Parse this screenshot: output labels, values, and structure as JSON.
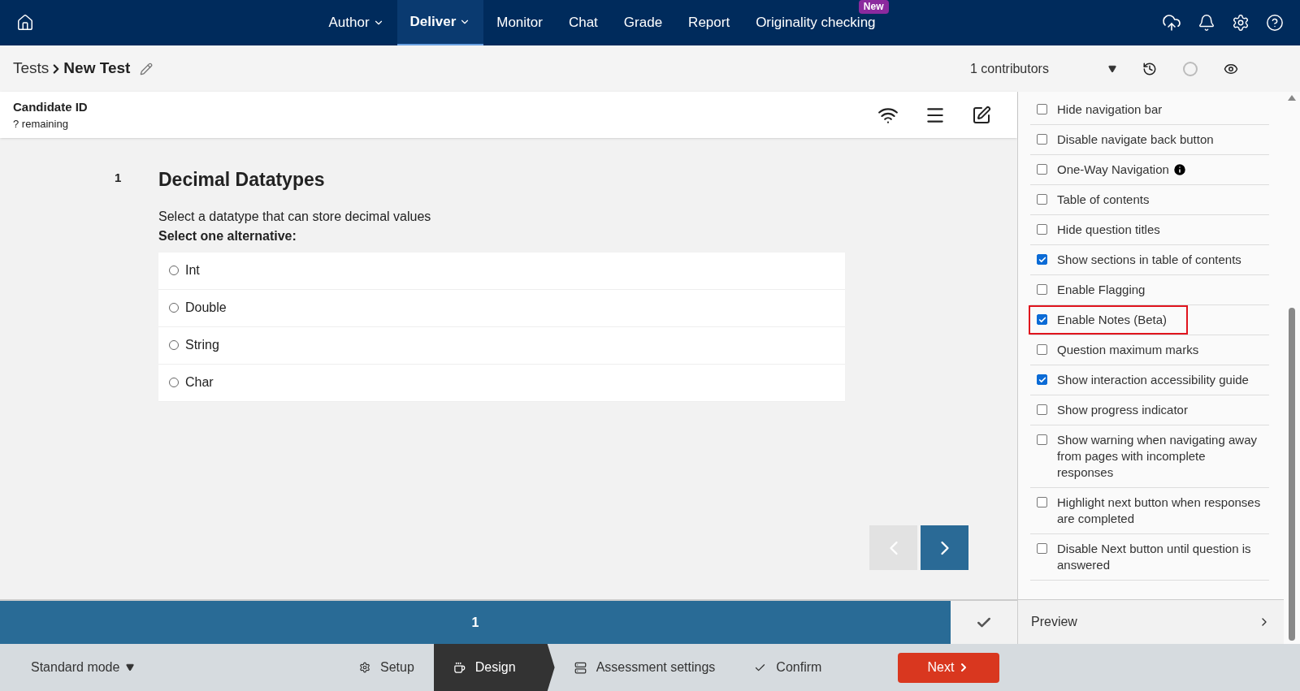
{
  "nav": {
    "items": [
      {
        "label": "Author",
        "dropdown": true,
        "selected": false
      },
      {
        "label": "Deliver",
        "dropdown": true,
        "selected": true
      },
      {
        "label": "Monitor",
        "dropdown": false,
        "selected": false
      },
      {
        "label": "Chat",
        "dropdown": false,
        "selected": false
      },
      {
        "label": "Grade",
        "dropdown": false,
        "selected": false
      },
      {
        "label": "Report",
        "dropdown": false,
        "selected": false
      },
      {
        "label": "Originality checking",
        "dropdown": false,
        "selected": false,
        "badge": "New"
      }
    ]
  },
  "breadcrumb": {
    "parent": "Tests",
    "current": "New Test"
  },
  "contributors": "1 contributors",
  "preview": {
    "candidate": "Candidate ID",
    "remaining": "? remaining",
    "question": {
      "number": "1",
      "title": "Decimal Datatypes",
      "prompt": "Select a datatype that can store decimal values",
      "instruction": "Select one alternative:",
      "options": [
        {
          "label": "Int",
          "selected": false
        },
        {
          "label": "Double",
          "selected": false
        },
        {
          "label": "String",
          "selected": false
        },
        {
          "label": "Char",
          "selected": false
        }
      ]
    },
    "progress": {
      "page": "1"
    }
  },
  "settings": [
    {
      "label": "Hide navigation bar",
      "checked": false,
      "highlighted": false
    },
    {
      "label": "Disable navigate back button",
      "checked": false,
      "highlighted": false
    },
    {
      "label": "One-Way Navigation",
      "checked": false,
      "highlighted": false,
      "info": true
    },
    {
      "label": "Table of contents",
      "checked": false,
      "highlighted": false
    },
    {
      "label": "Hide question titles",
      "checked": false,
      "highlighted": false
    },
    {
      "label": "Show sections in table of contents",
      "checked": true,
      "highlighted": false
    },
    {
      "label": "Enable Flagging",
      "checked": false,
      "highlighted": false
    },
    {
      "label": "Enable Notes (Beta)",
      "checked": true,
      "highlighted": true
    },
    {
      "label": "Question maximum marks",
      "checked": false,
      "highlighted": false
    },
    {
      "label": "Show interaction accessibility guide",
      "checked": true,
      "highlighted": false
    },
    {
      "label": "Show progress indicator",
      "checked": false,
      "highlighted": false
    },
    {
      "label": "Show warning when navigating away from pages with incomplete responses",
      "checked": false,
      "highlighted": false
    },
    {
      "label": "Highlight next button when responses are completed",
      "checked": false,
      "highlighted": false
    },
    {
      "label": "Disable Next button until question is answered",
      "checked": false,
      "highlighted": false
    }
  ],
  "preview_link": "Preview",
  "footer": {
    "mode": "Standard mode",
    "steps": [
      {
        "label": "Setup",
        "kind": "setup",
        "selected": false
      },
      {
        "label": "Design",
        "kind": "design",
        "selected": true
      },
      {
        "label": "Assessment settings",
        "kind": "settings",
        "selected": false
      },
      {
        "label": "Confirm",
        "kind": "confirm",
        "selected": false
      }
    ],
    "next": "Next"
  }
}
